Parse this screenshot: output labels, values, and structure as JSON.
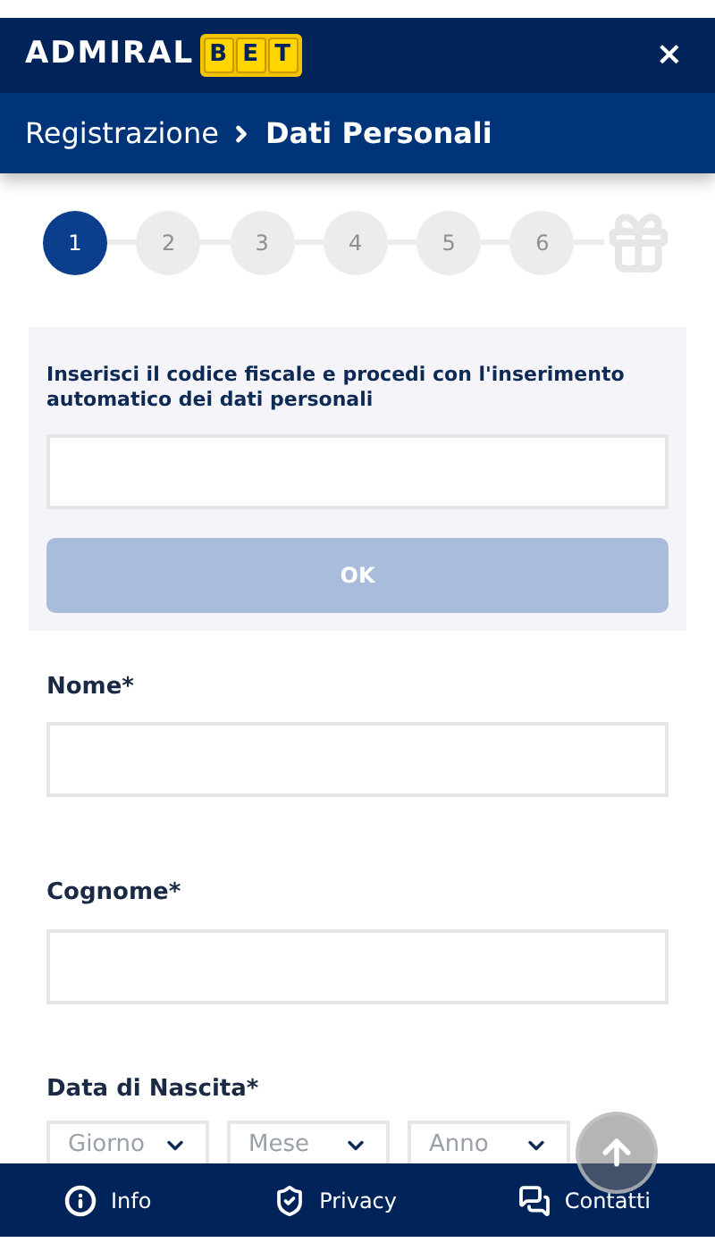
{
  "header": {
    "logo_text": "ADMIRAL",
    "logo_badge": [
      "B",
      "E",
      "T"
    ],
    "close": "×"
  },
  "breadcrumb": {
    "parent": "Registrazione",
    "current": "Dati Personali"
  },
  "steps": [
    {
      "label": "1",
      "selected": true
    },
    {
      "label": "2",
      "selected": false
    },
    {
      "label": "3",
      "selected": false
    },
    {
      "label": "4",
      "selected": false
    },
    {
      "label": "5",
      "selected": false
    },
    {
      "label": "6",
      "selected": false
    }
  ],
  "fiscal_code": {
    "instruction": "Inserisci il codice fiscale e procedi con l'inserimento automatico dei dati personali",
    "button": "OK",
    "disabled": true
  },
  "fields": [
    {
      "label": "Nome*"
    },
    {
      "label": "Cognome*"
    }
  ],
  "birth_date": {
    "label": "Data di Nascita*",
    "selects": [
      {
        "placeholder": "Giorno"
      },
      {
        "placeholder": "Mese"
      },
      {
        "placeholder": "Anno"
      }
    ]
  },
  "footer": [
    {
      "kind": "info",
      "label": "Info"
    },
    {
      "kind": "privacy",
      "label": "Privacy"
    },
    {
      "kind": "contacts",
      "label": "Contatti"
    }
  ]
}
